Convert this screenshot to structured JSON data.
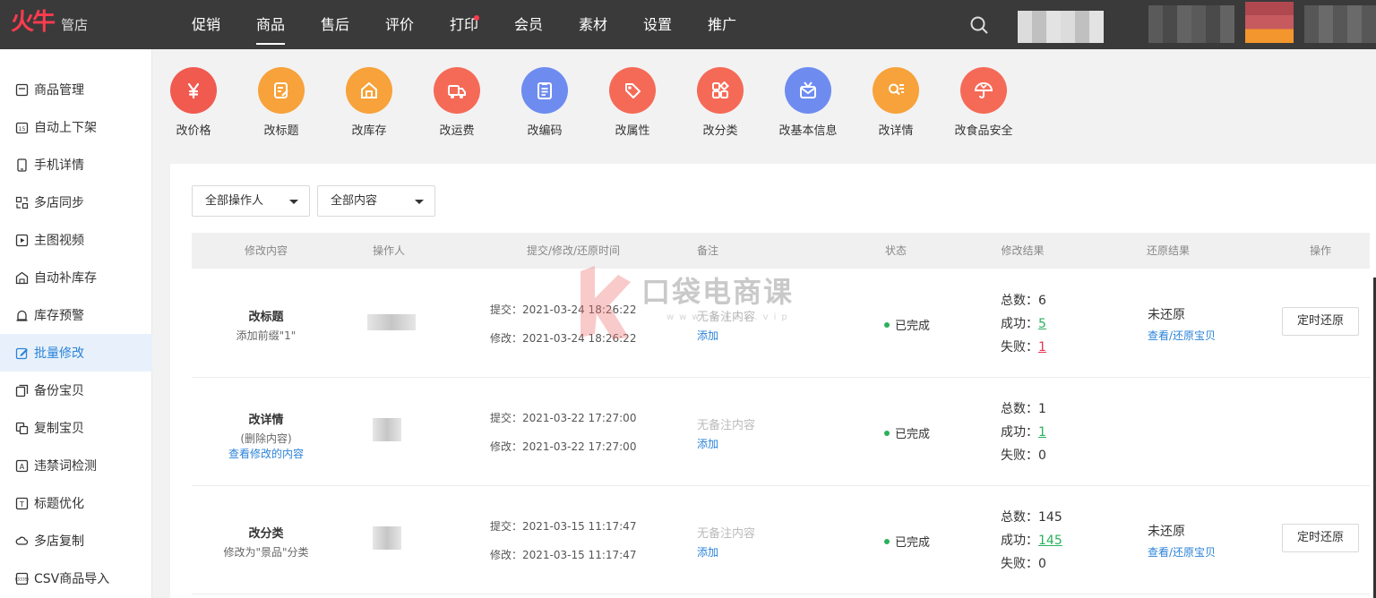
{
  "app": {
    "logo_text": "火牛",
    "logo_sub": "管店"
  },
  "nav": [
    {
      "label": "促销",
      "active": false,
      "dot": false
    },
    {
      "label": "商品",
      "active": true,
      "dot": false
    },
    {
      "label": "售后",
      "active": false,
      "dot": false
    },
    {
      "label": "评价",
      "active": false,
      "dot": false
    },
    {
      "label": "打印",
      "active": false,
      "dot": true
    },
    {
      "label": "会员",
      "active": false,
      "dot": false
    },
    {
      "label": "素材",
      "active": false,
      "dot": false
    },
    {
      "label": "设置",
      "active": false,
      "dot": false
    },
    {
      "label": "推广",
      "active": false,
      "dot": false
    }
  ],
  "sidebar": {
    "items": [
      {
        "label": "商品管理",
        "icon": "list-icon"
      },
      {
        "label": "自动上下架",
        "icon": "calendar-icon"
      },
      {
        "label": "手机详情",
        "icon": "phone-icon"
      },
      {
        "label": "多店同步",
        "icon": "sync-icon"
      },
      {
        "label": "主图视频",
        "icon": "video-icon"
      },
      {
        "label": "自动补库存",
        "icon": "warehouse-icon"
      },
      {
        "label": "库存预警",
        "icon": "alarm-icon"
      },
      {
        "label": "批量修改",
        "icon": "edit-icon"
      },
      {
        "label": "备份宝贝",
        "icon": "backup-icon"
      },
      {
        "label": "复制宝贝",
        "icon": "copy-icon"
      },
      {
        "label": "违禁词检测",
        "icon": "text-check-icon"
      },
      {
        "label": "标题优化",
        "icon": "title-icon"
      },
      {
        "label": "多店复制",
        "icon": "cloud-icon"
      },
      {
        "label": "CSV商品导入",
        "icon": "csv-icon"
      }
    ],
    "active_index": 7,
    "colors": {
      "active_bg": "#e8f1fb",
      "active_text": "#2b83d8"
    }
  },
  "quick_actions": [
    {
      "label": "改价格",
      "icon": "yen-icon",
      "color": "#f05a4f"
    },
    {
      "label": "改标题",
      "icon": "edit-doc-icon",
      "color": "#f7a23a"
    },
    {
      "label": "改库存",
      "icon": "house-icon",
      "color": "#f7a23a"
    },
    {
      "label": "改运费",
      "icon": "truck-icon",
      "color": "#f56a57"
    },
    {
      "label": "改编码",
      "icon": "clipboard-icon",
      "color": "#6e8cf0"
    },
    {
      "label": "改属性",
      "icon": "tag-icon",
      "color": "#f56a57"
    },
    {
      "label": "改分类",
      "icon": "category-icon",
      "color": "#f56a57"
    },
    {
      "label": "改基本信息",
      "icon": "mail-icon",
      "color": "#6e8cf0"
    },
    {
      "label": "改详情",
      "icon": "search-list-icon",
      "color": "#f7a23a"
    },
    {
      "label": "改食品安全",
      "icon": "umbrella-icon",
      "color": "#f56a57"
    }
  ],
  "filters": [
    {
      "value": "全部操作人"
    },
    {
      "value": "全部内容"
    }
  ],
  "table": {
    "headers": [
      "修改内容",
      "操作人",
      "提交/修改/还原时间",
      "备注",
      "状态",
      "修改结果",
      "还原结果",
      "操作"
    ],
    "rows": [
      {
        "title": "改标题",
        "subtitle": "添加前缀\"1\"",
        "view_link": "",
        "submit_time": "提交：2021-03-24 18:26:22",
        "modify_time": "修改：2021-03-24 18:26:22",
        "remark": "无备注内容",
        "add_link": "添加",
        "status": "已完成",
        "total_label": "总数：",
        "total": "6",
        "success_label": "成功：",
        "success": "5",
        "fail_label": "失败：",
        "fail": "1",
        "fail_red": true,
        "restore_status": "未还原",
        "restore_link": "查看/还原宝贝",
        "button": "定时还原"
      },
      {
        "title": "改详情",
        "subtitle": "(删除内容)",
        "view_link": "查看修改的内容",
        "submit_time": "提交：2021-03-22 17:27:00",
        "modify_time": "修改：2021-03-22 17:27:00",
        "remark": "无备注内容",
        "add_link": "添加",
        "status": "已完成",
        "total_label": "总数：",
        "total": "1",
        "success_label": "成功：",
        "success": "1",
        "fail_label": "失败：",
        "fail": "0",
        "fail_red": false,
        "restore_status": "",
        "restore_link": "",
        "button": ""
      },
      {
        "title": "改分类",
        "subtitle": "修改为\"景品\"分类",
        "view_link": "",
        "submit_time": "提交：2021-03-15 11:17:47",
        "modify_time": "修改：2021-03-15 11:17:47",
        "remark": "无备注内容",
        "add_link": "添加",
        "status": "已完成",
        "total_label": "总数：",
        "total": "145",
        "success_label": "成功：",
        "success": "145",
        "fail_label": "失败：",
        "fail": "0",
        "fail_red": false,
        "restore_status": "未还原",
        "restore_link": "查看/还原宝贝",
        "button": "定时还原"
      }
    ]
  },
  "watermark": {
    "text": "口袋电商课",
    "sub": "www.kdds.vip"
  }
}
